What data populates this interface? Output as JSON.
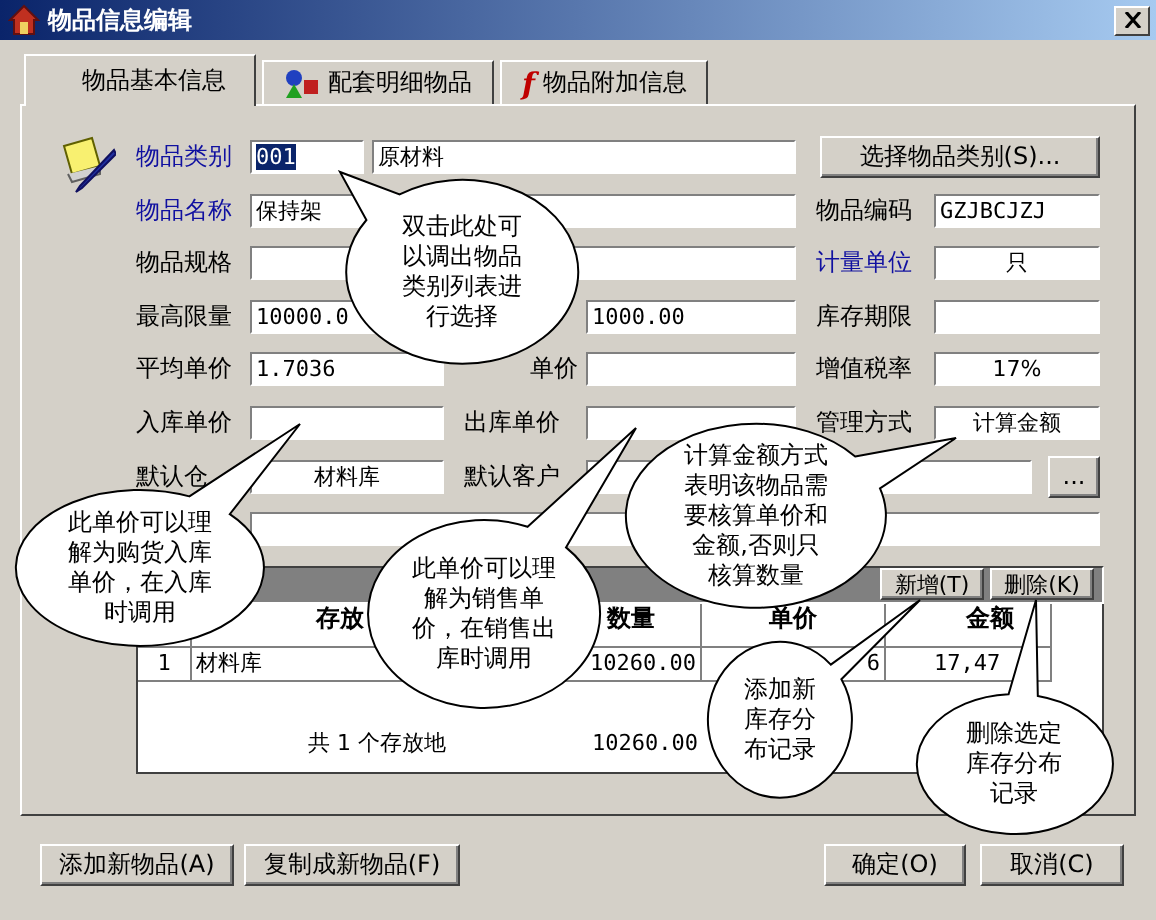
{
  "window": {
    "title": "物品信息编辑"
  },
  "tabs": [
    {
      "label": "物品基本信息",
      "selected": true
    },
    {
      "label": "配套明细物品",
      "selected": false
    },
    {
      "label": "物品附加信息",
      "selected": false,
      "glyph": "f"
    }
  ],
  "form": [
    [
      {
        "kind": "icon"
      },
      {
        "kind": "label",
        "text": "物品类别",
        "required": true
      },
      {
        "kind": "field",
        "value": "001",
        "selected": true
      },
      {
        "kind": "field",
        "value": "原材料",
        "selected": false
      },
      {
        "kind": "button",
        "label": "选择物品类别(S)..."
      }
    ],
    [
      {
        "kind": "label",
        "text": "物品名称",
        "required": true
      },
      {
        "kind": "field",
        "value": "保持架"
      },
      {
        "kind": "label",
        "text": "物品编码",
        "required": false
      },
      {
        "kind": "field",
        "value": "GZJBCJZJ"
      }
    ],
    [
      {
        "kind": "label",
        "text": "物品规格",
        "required": false
      },
      {
        "kind": "field"
      },
      {
        "kind": "label",
        "text": "计量单位",
        "required": true
      },
      {
        "kind": "choice",
        "value": "只"
      }
    ],
    [
      {
        "kind": "label",
        "text": "最高限量",
        "required": false
      },
      {
        "kind": "field",
        "value": "10000.0"
      },
      {
        "kind": "field",
        "value": "1000.00"
      },
      {
        "kind": "label",
        "text": "库存期限",
        "required": false
      },
      {
        "kind": "field"
      }
    ],
    [
      {
        "kind": "label",
        "text": "平均单价",
        "required": false
      },
      {
        "kind": "field",
        "value": "1.7036"
      },
      {
        "kind": "label",
        "text": "单价",
        "required": false
      },
      {
        "kind": "field"
      },
      {
        "kind": "label",
        "text": "增值税率",
        "required": false
      },
      {
        "kind": "choice",
        "value": "17%"
      }
    ],
    [
      {
        "kind": "label",
        "text": "入库单价",
        "required": false
      },
      {
        "kind": "field"
      },
      {
        "kind": "label",
        "text": "出库单价",
        "required": false
      },
      {
        "kind": "field"
      },
      {
        "kind": "label",
        "text": "管理方式",
        "required": false
      },
      {
        "kind": "choice",
        "value": "计算金额"
      }
    ],
    [
      {
        "kind": "label",
        "text": "默认仓",
        "required": false
      },
      {
        "kind": "choice",
        "value": "材料库"
      },
      {
        "kind": "label",
        "text": "默认客户",
        "required": false
      },
      {
        "kind": "field"
      },
      {
        "kind": "button",
        "label": "..."
      }
    ],
    [
      {
        "kind": "field"
      }
    ]
  ],
  "stock": {
    "buttons": [
      "新增(T)",
      "删除(K)"
    ],
    "columns": [
      "",
      "存放",
      "数量",
      "单价",
      "金额"
    ],
    "rows": [
      [
        "1",
        "材料库",
        "10260.00",
        "6",
        "17,47"
      ]
    ],
    "footer": [
      "共 1 个存放地",
      "10260.00"
    ]
  },
  "buttons": [
    "添加新物品(A)",
    "复制成新物品(F)",
    "确定(O)",
    "取消(C)"
  ],
  "callouts": [
    {
      "text": "双击此处可以调出物品类别列表进行选择"
    },
    {
      "text": "此单价可以理解为购货入库单价，在入库时调用"
    },
    {
      "text": "此单价可以理解为销售单价，在销售出库时调用"
    },
    {
      "text": "计算金额方式表明该物品需要核算单价和金额,否则只核算数量"
    },
    {
      "text": "添加新库存分布记录"
    },
    {
      "text": "删除选定库存分布记录"
    }
  ]
}
